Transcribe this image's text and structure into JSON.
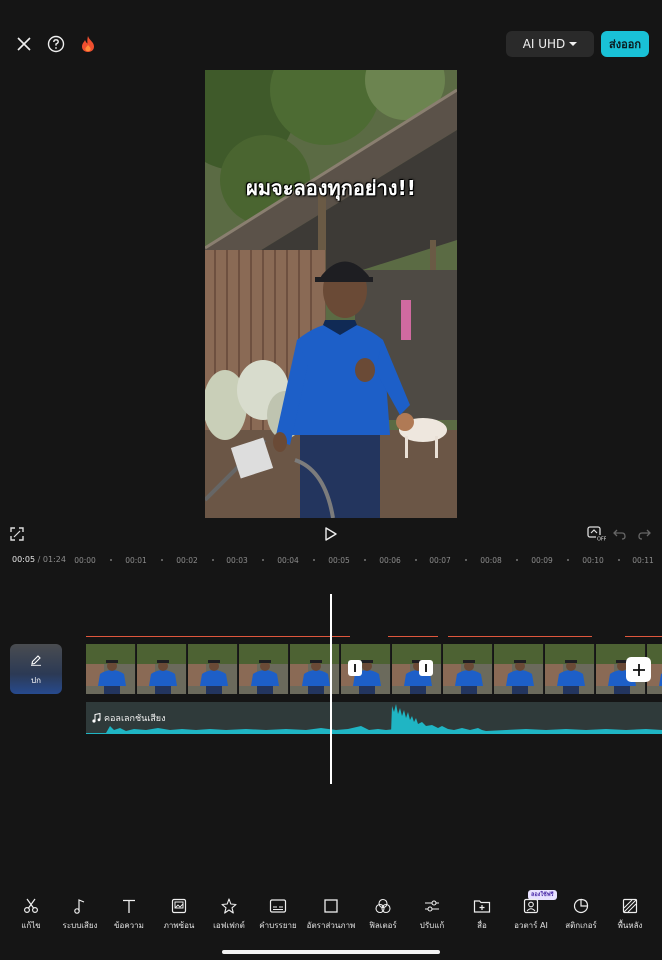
{
  "header": {
    "quality_label": "AI UHD",
    "export_label": "ส่งออก"
  },
  "preview": {
    "caption": "ผมจะลองทุกอย่าง!!"
  },
  "playback": {
    "current_time": "00:05",
    "separator": "/",
    "total_time": "01:24"
  },
  "ruler": {
    "ticks": [
      "00:00",
      "00:01",
      "00:02",
      "00:03",
      "00:04",
      "00:05",
      "00:06",
      "00:07",
      "00:08",
      "00:09",
      "00:10",
      "00:11"
    ]
  },
  "timeline": {
    "cover_label": "ปก",
    "audio_label": "คอลเลกชันเสียง"
  },
  "toolbar": {
    "items": [
      {
        "label": "แก้ไข",
        "icon": "scissors-icon"
      },
      {
        "label": "ระบบเสียง",
        "icon": "music-note-icon"
      },
      {
        "label": "ข้อความ",
        "icon": "text-icon"
      },
      {
        "label": "ภาพซ้อน",
        "icon": "overlay-icon"
      },
      {
        "label": "เอฟเฟกต์",
        "icon": "sparkle-icon"
      },
      {
        "label": "คำบรรยาย",
        "icon": "captions-icon"
      },
      {
        "label": "อัตราส่วนภาพ",
        "icon": "aspect-ratio-icon"
      },
      {
        "label": "ฟิลเตอร์",
        "icon": "filter-icon"
      },
      {
        "label": "ปรับแก้",
        "icon": "adjust-icon"
      },
      {
        "label": "สื่อ",
        "icon": "media-icon"
      },
      {
        "label": "อวตาร์ AI",
        "icon": "avatar-icon"
      },
      {
        "label": "สติกเกอร์",
        "icon": "sticker-icon"
      },
      {
        "label": "พื้นหลัง",
        "icon": "background-icon"
      }
    ],
    "avatar_badge": "ลองใช้ฟรี"
  },
  "colors": {
    "accent": "#19c1d7",
    "background": "#151515",
    "audio_wave": "#1fb5c4",
    "clip_marker": "#e0573d"
  }
}
